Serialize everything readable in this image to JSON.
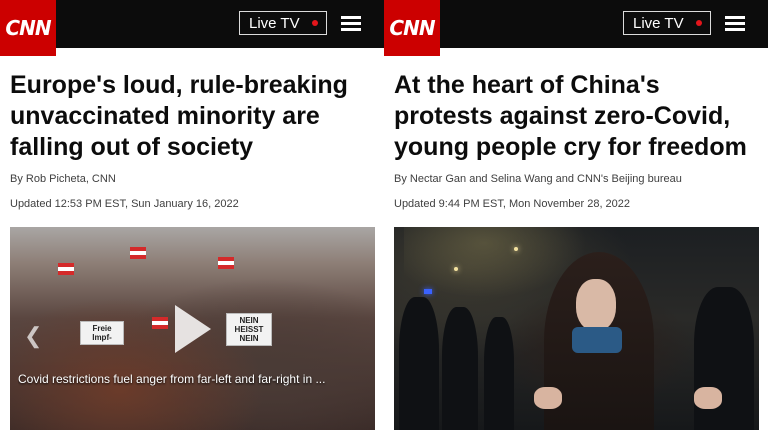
{
  "brand": {
    "logo": "CNN",
    "color": "#cc0000"
  },
  "header": {
    "live_tv_label": "Live TV",
    "live_dot_color": "#e4151b",
    "menu_icon": "hamburger-menu-icon"
  },
  "articles": [
    {
      "headline": "Europe's loud, rule-breaking unvaccinated minority are falling out of society",
      "byline": "By Rob Picheta, CNN",
      "updated": "Updated 12:53 PM EST, Sun January 16, 2022",
      "media": {
        "caption": "Covid restrictions fuel anger from far-left and far-right in ...",
        "sign_text": "NEIN HEISST NEIN",
        "sign_text_2": "Freie Impf-",
        "play_icon": "play-icon",
        "back_icon": "chevron-left-icon"
      }
    },
    {
      "headline": "At the heart of China's protests against zero-Covid, young people cry for freedom",
      "byline": "By Nectar Gan and Selina Wang and CNN's Beijing bureau",
      "updated": "Updated 9:44 PM EST, Mon November 28, 2022"
    }
  ]
}
